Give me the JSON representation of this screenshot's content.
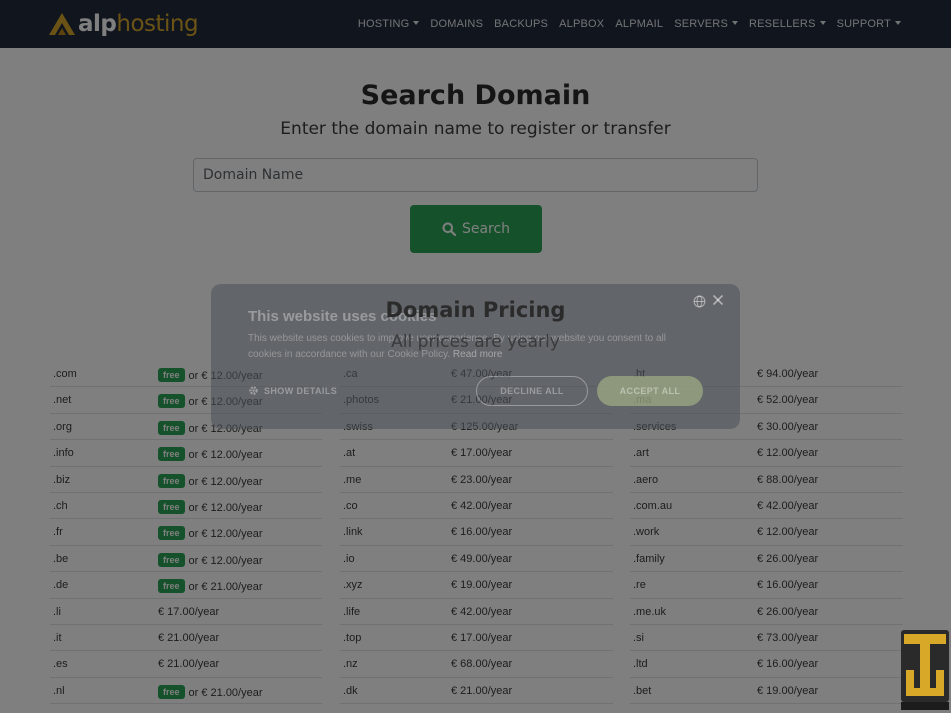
{
  "brand": {
    "name_part1": "alp",
    "name_part2": "hosting"
  },
  "nav": [
    {
      "label": "HOSTING",
      "dropdown": true
    },
    {
      "label": "DOMAINS",
      "dropdown": false
    },
    {
      "label": "BACKUPS",
      "dropdown": false
    },
    {
      "label": "ALPBOX",
      "dropdown": false
    },
    {
      "label": "ALPMAIL",
      "dropdown": false
    },
    {
      "label": "SERVERS",
      "dropdown": true
    },
    {
      "label": "RESELLERS",
      "dropdown": true
    },
    {
      "label": "SUPPORT",
      "dropdown": true
    }
  ],
  "search": {
    "title": "Search Domain",
    "subtitle": "Enter the domain name to register or transfer",
    "placeholder": "Domain Name",
    "button_label": "Search"
  },
  "pricing": {
    "title": "Domain Pricing",
    "subtitle": "All prices are yearly",
    "columns": [
      [
        {
          "tld": ".com",
          "free": true,
          "price": "or € 12.00/year"
        },
        {
          "tld": ".net",
          "free": true,
          "price": "or € 12.00/year"
        },
        {
          "tld": ".org",
          "free": true,
          "price": "or € 12.00/year"
        },
        {
          "tld": ".info",
          "free": true,
          "price": "or € 12.00/year"
        },
        {
          "tld": ".biz",
          "free": true,
          "price": "or € 12.00/year"
        },
        {
          "tld": ".ch",
          "free": true,
          "price": "or € 12.00/year"
        },
        {
          "tld": ".fr",
          "free": true,
          "price": "or € 12.00/year"
        },
        {
          "tld": ".be",
          "free": true,
          "price": "or € 12.00/year"
        },
        {
          "tld": ".de",
          "free": true,
          "price": "or € 21.00/year"
        },
        {
          "tld": ".li",
          "free": false,
          "price": "€ 17.00/year"
        },
        {
          "tld": ".it",
          "free": false,
          "price": "€ 21.00/year"
        },
        {
          "tld": ".es",
          "free": false,
          "price": "€ 21.00/year"
        },
        {
          "tld": ".nl",
          "free": true,
          "price": "or € 21.00/year"
        }
      ],
      [
        {
          "tld": ".ca",
          "free": false,
          "price": "€ 47.00/year"
        },
        {
          "tld": ".photos",
          "free": false,
          "price": "€ 21.00/year"
        },
        {
          "tld": ".swiss",
          "free": false,
          "price": "€ 125.00/year"
        },
        {
          "tld": ".at",
          "free": false,
          "price": "€ 17.00/year"
        },
        {
          "tld": ".me",
          "free": false,
          "price": "€ 23.00/year"
        },
        {
          "tld": ".co",
          "free": false,
          "price": "€ 42.00/year"
        },
        {
          "tld": ".link",
          "free": false,
          "price": "€ 16.00/year"
        },
        {
          "tld": ".io",
          "free": false,
          "price": "€ 49.00/year"
        },
        {
          "tld": ".xyz",
          "free": false,
          "price": "€ 19.00/year"
        },
        {
          "tld": ".life",
          "free": false,
          "price": "€ 42.00/year"
        },
        {
          "tld": ".top",
          "free": false,
          "price": "€ 17.00/year"
        },
        {
          "tld": ".nz",
          "free": false,
          "price": "€ 68.00/year"
        },
        {
          "tld": ".dk",
          "free": false,
          "price": "€ 21.00/year"
        }
      ],
      [
        {
          "tld": ".ht",
          "free": false,
          "price": "€ 94.00/year"
        },
        {
          "tld": ".ma",
          "free": false,
          "price": "€ 52.00/year"
        },
        {
          "tld": ".services",
          "free": false,
          "price": "€ 30.00/year"
        },
        {
          "tld": ".art",
          "free": false,
          "price": "€ 12.00/year"
        },
        {
          "tld": ".aero",
          "free": false,
          "price": "€ 88.00/year"
        },
        {
          "tld": ".com.au",
          "free": false,
          "price": "€ 42.00/year"
        },
        {
          "tld": ".work",
          "free": false,
          "price": "€ 12.00/year"
        },
        {
          "tld": ".family",
          "free": false,
          "price": "€ 26.00/year"
        },
        {
          "tld": ".re",
          "free": false,
          "price": "€ 16.00/year"
        },
        {
          "tld": ".me.uk",
          "free": false,
          "price": "€ 26.00/year"
        },
        {
          "tld": ".si",
          "free": false,
          "price": "€ 73.00/year"
        },
        {
          "tld": ".ltd",
          "free": false,
          "price": "€ 16.00/year"
        },
        {
          "tld": ".bet",
          "free": false,
          "price": "€ 19.00/year"
        }
      ]
    ],
    "free_label": "free"
  },
  "cookie": {
    "title": "This website uses cookies",
    "text": "This website uses cookies to improve user experience. By using our website you consent to all cookies in accordance with our Cookie Policy.",
    "read_more": "Read more",
    "show_details": "SHOW DETAILS",
    "decline": "DECLINE ALL",
    "accept": "ACCEPT ALL"
  },
  "colors": {
    "header": "#232d3d",
    "accent_green": "#2ba556",
    "brand_gold": "#d7a72b"
  },
  "icons": [
    "logo-mark-icon",
    "search-icon",
    "gear-icon",
    "globe-icon",
    "close-icon",
    "watermark-logo"
  ]
}
